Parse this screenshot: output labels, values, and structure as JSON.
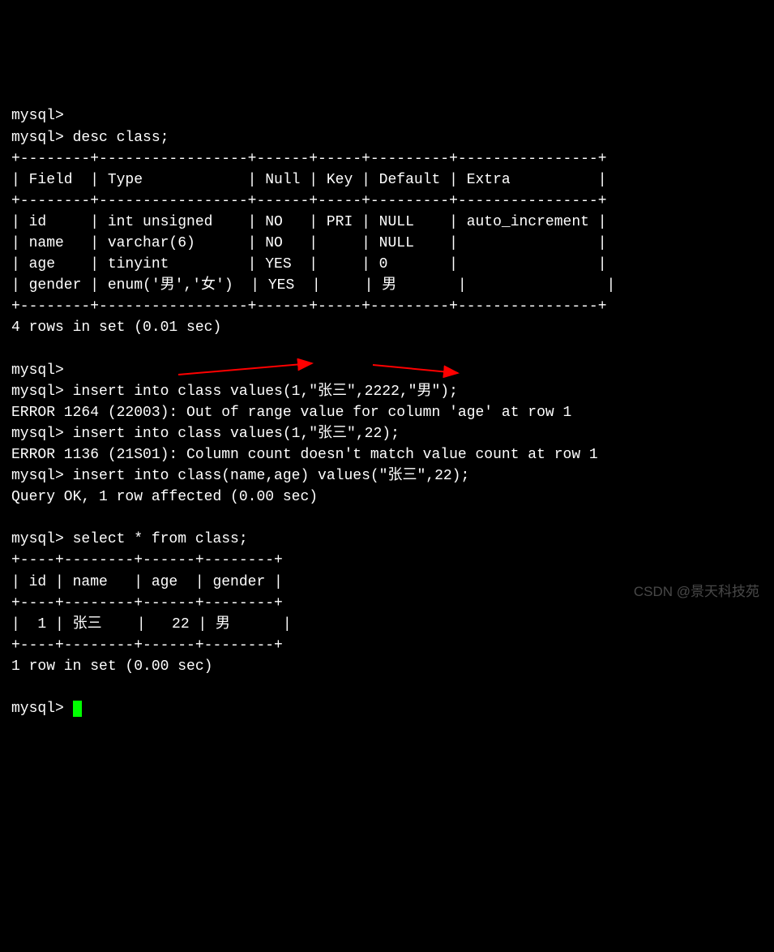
{
  "lines": {
    "l0": "mysql>",
    "l1": "mysql> desc class;",
    "l2": "+--------+-----------------+------+-----+---------+----------------+",
    "l3": "| Field  | Type            | Null | Key | Default | Extra          |",
    "l4": "+--------+-----------------+------+-----+---------+----------------+",
    "l5": "| id     | int unsigned    | NO   | PRI | NULL    | auto_increment |",
    "l6": "| name   | varchar(6)      | NO   |     | NULL    |                |",
    "l7": "| age    | tinyint         | YES  |     | 0       |                |",
    "l8": "| gender | enum('男','女')  | YES  |     | 男       |                |",
    "l9": "+--------+-----------------+------+-----+---------+----------------+",
    "l10": "4 rows in set (0.01 sec)",
    "l11": "",
    "l12": "mysql>",
    "l13": "mysql> insert into class values(1,\"张三\",2222,\"男\");",
    "l14": "ERROR 1264 (22003): Out of range value for column 'age' at row 1",
    "l15": "mysql> insert into class values(1,\"张三\",22);",
    "l16": "ERROR 1136 (21S01): Column count doesn't match value count at row 1",
    "l17": "mysql> insert into class(name,age) values(\"张三\",22);",
    "l18": "Query OK, 1 row affected (0.00 sec)",
    "l19": "",
    "l20": "mysql> select * from class;",
    "l21": "+----+--------+------+--------+",
    "l22": "| id | name   | age  | gender |",
    "l23": "+----+--------+------+--------+",
    "l24": "|  1 | 张三    |   22 | 男      |",
    "l25": "+----+--------+------+--------+",
    "l26": "1 row in set (0.00 sec)",
    "l27": "",
    "l28": "mysql> "
  },
  "watermark": "CSDN @景天科技苑",
  "desc_table": {
    "columns": [
      "Field",
      "Type",
      "Null",
      "Key",
      "Default",
      "Extra"
    ],
    "rows": [
      {
        "Field": "id",
        "Type": "int unsigned",
        "Null": "NO",
        "Key": "PRI",
        "Default": "NULL",
        "Extra": "auto_increment"
      },
      {
        "Field": "name",
        "Type": "varchar(6)",
        "Null": "NO",
        "Key": "",
        "Default": "NULL",
        "Extra": ""
      },
      {
        "Field": "age",
        "Type": "tinyint",
        "Null": "YES",
        "Key": "",
        "Default": "0",
        "Extra": ""
      },
      {
        "Field": "gender",
        "Type": "enum('男','女')",
        "Null": "YES",
        "Key": "",
        "Default": "男",
        "Extra": ""
      }
    ]
  },
  "select_table": {
    "columns": [
      "id",
      "name",
      "age",
      "gender"
    ],
    "rows": [
      {
        "id": 1,
        "name": "张三",
        "age": 22,
        "gender": "男"
      }
    ]
  },
  "annotations": {
    "arrow1": {
      "desc": "red arrow pointing to class(name,age)"
    },
    "arrow2": {
      "desc": "red arrow pointing to values(\"张三\",22)"
    }
  }
}
